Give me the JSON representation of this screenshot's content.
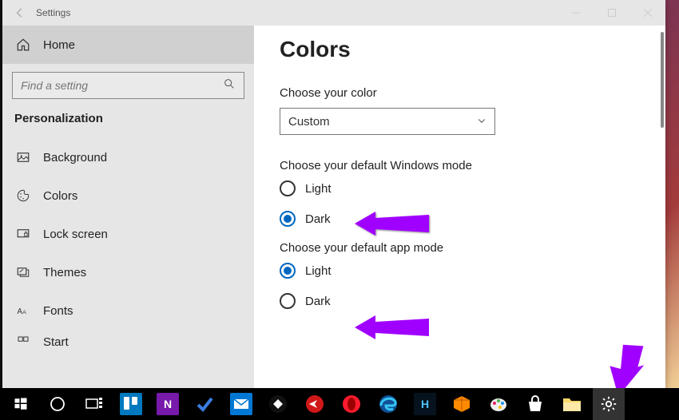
{
  "window": {
    "title": "Settings"
  },
  "sidebar": {
    "home": "Home",
    "search_placeholder": "Find a setting",
    "section": "Personalization",
    "items": [
      {
        "label": "Background"
      },
      {
        "label": "Colors"
      },
      {
        "label": "Lock screen"
      },
      {
        "label": "Themes"
      },
      {
        "label": "Fonts"
      },
      {
        "label": "Start"
      }
    ]
  },
  "content": {
    "heading": "Colors",
    "color_mode_label": "Choose your color",
    "color_mode_value": "Custom",
    "win_mode_label": "Choose your default Windows mode",
    "win_mode_options": {
      "light": "Light",
      "dark": "Dark"
    },
    "win_mode_selected": "dark",
    "app_mode_label": "Choose your default app mode",
    "app_mode_options": {
      "light": "Light",
      "dark": "Dark"
    },
    "app_mode_selected": "light"
  },
  "taskbar_labels": [
    "start",
    "cortana",
    "task-view",
    "trello",
    "onenote",
    "todo",
    "mail",
    "clipboard",
    "locate",
    "opera",
    "edge",
    "hterm",
    "3d",
    "paint",
    "store",
    "files",
    "settings"
  ]
}
